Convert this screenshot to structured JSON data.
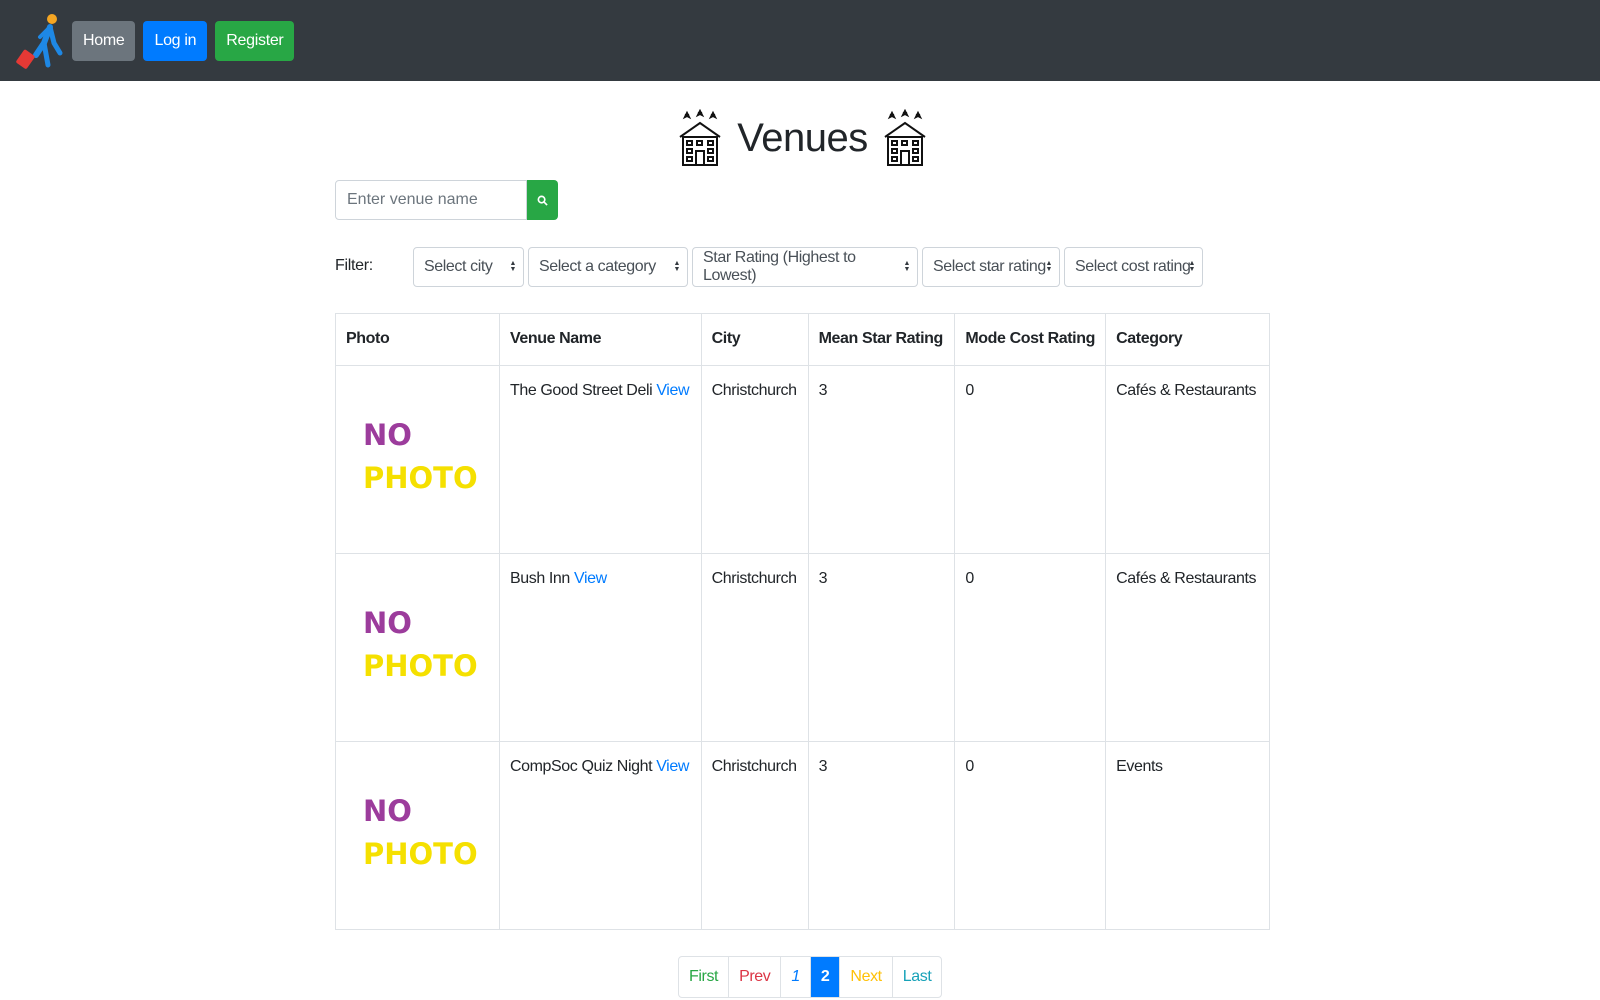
{
  "nav": {
    "home_label": "Home",
    "login_label": "Log in",
    "register_label": "Register",
    "logo_icon": "traveler-with-suitcase-icon"
  },
  "page": {
    "title": "Venues",
    "title_icon": "hotel-icon"
  },
  "search": {
    "placeholder": "Enter venue name",
    "button_icon": "search-icon"
  },
  "filters": {
    "label": "Filter:",
    "city": "Select city",
    "category": "Select a category",
    "sort": "Star Rating (Highest to Lowest)",
    "star_rating": "Select star rating",
    "cost_rating": "Select cost rating"
  },
  "table": {
    "headers": {
      "photo": "Photo",
      "venue_name": "Venue Name",
      "city": "City",
      "mean_star": "Mean Star Rating",
      "mode_cost": "Mode Cost Rating",
      "category": "Category"
    },
    "no_photo_line1": "NO",
    "no_photo_line2": "PHOTO",
    "view_label": "View",
    "rows": [
      {
        "name": "The Good Street Deli",
        "city": "Christchurch",
        "mean_star": "3",
        "mode_cost": "0",
        "category": "Cafés & Restaurants"
      },
      {
        "name": "Bush Inn",
        "city": "Christchurch",
        "mean_star": "3",
        "mode_cost": "0",
        "category": "Cafés & Restaurants"
      },
      {
        "name": "CompSoc Quiz Night",
        "city": "Christchurch",
        "mean_star": "3",
        "mode_cost": "0",
        "category": "Events"
      }
    ]
  },
  "pagination": {
    "first": "First",
    "prev": "Prev",
    "page1": "1",
    "page2": "2",
    "next": "Next",
    "last": "Last"
  },
  "colors": {
    "navbar": "#343a40",
    "primary": "#007bff",
    "success": "#28a745",
    "secondary": "#6c757d",
    "danger": "#dc3545",
    "warning": "#ffc107",
    "info": "#17a2b8",
    "no_photo_purple": "#9c3c9c",
    "no_photo_yellow": "#f5e000"
  }
}
